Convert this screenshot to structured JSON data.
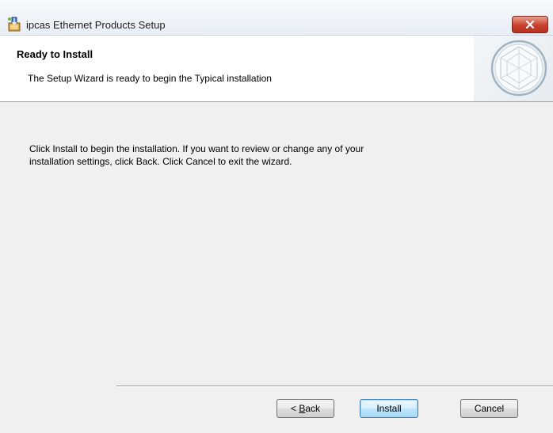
{
  "window": {
    "title": "ipcas Ethernet Products Setup",
    "close_icon": "close-icon",
    "accent_color": "#c9402d"
  },
  "banner": {
    "title": "Ready to Install",
    "description": "The Setup Wizard is ready to begin the Typical installation"
  },
  "main": {
    "line1": "Click Install to begin the installation.  If you want to review or change any of your",
    "line2": "installation settings, click Back.  Click Cancel to exit the wizard."
  },
  "buttons": {
    "back_prefix": "< ",
    "back_underlined": "B",
    "back_rest": "ack",
    "install_label": "Install",
    "cancel_label": "Cancel"
  }
}
